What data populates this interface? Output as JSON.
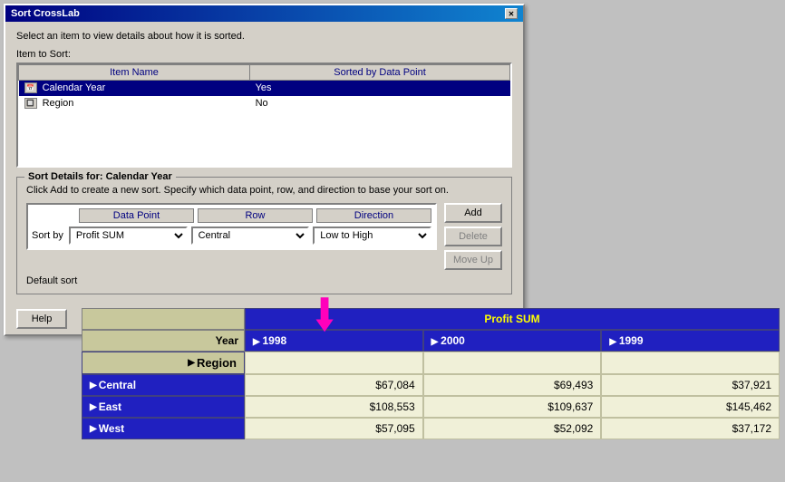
{
  "dialog": {
    "title": "Sort CrossLab",
    "instruction": "Select an item to view details about how it is sorted.",
    "item_to_sort_label": "Item to Sort:",
    "table": {
      "col1": "Item Name",
      "col2": "Sorted by Data Point",
      "rows": [
        {
          "icon": "📅",
          "name": "Calendar Year",
          "sorted": "Yes",
          "selected": true
        },
        {
          "icon": "🔲",
          "name": "Region",
          "sorted": "No",
          "selected": false
        }
      ]
    },
    "sort_details_title": "Sort Details for: Calendar Year",
    "sort_details_desc": "Click Add to create a new sort. Specify which data point, row, and direction to base your sort on.",
    "sort_controls": {
      "sort_by_label": "Sort by",
      "col_data_point": "Data Point",
      "col_row": "Row",
      "col_direction": "Direction",
      "data_point_value": "Profit SUM",
      "row_value": "Central",
      "direction_value": "Low to High",
      "add_label": "Add",
      "delete_label": "Delete",
      "move_up_label": "Move Up"
    },
    "default_sort_label": "Default sort",
    "help_label": "Help"
  },
  "crosstab": {
    "measure_header": "Profit SUM",
    "year_label": "Year",
    "years": [
      "1998",
      "2000",
      "1999"
    ],
    "region_header": "Region",
    "rows": [
      {
        "label": "Central",
        "values": [
          "$67,084",
          "$69,493",
          "$37,921"
        ]
      },
      {
        "label": "East",
        "values": [
          "$108,553",
          "$109,637",
          "$145,462"
        ]
      },
      {
        "label": "West",
        "values": [
          "$57,095",
          "$52,092",
          "$37,172"
        ]
      }
    ]
  },
  "arrow": "↓"
}
